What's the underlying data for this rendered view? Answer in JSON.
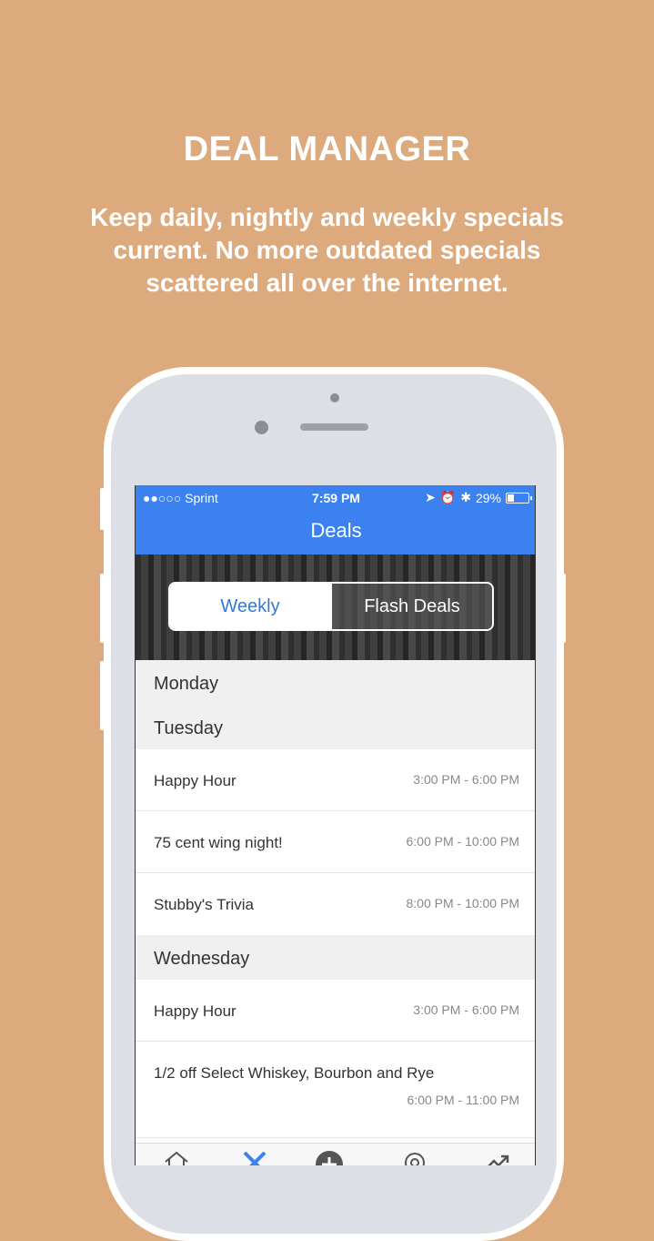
{
  "promo": {
    "headline": "DEAL MANAGER",
    "subtitle": "Keep daily, nightly and weekly specials current. No more outdated specials scattered all over the internet."
  },
  "status_bar": {
    "carrier": "●●○○○ Sprint",
    "time": "7:59 PM",
    "battery": "29%"
  },
  "nav": {
    "title": "Deals"
  },
  "segments": {
    "weekly": "Weekly",
    "flash": "Flash Deals"
  },
  "days": {
    "monday": "Monday",
    "tuesday": "Tuesday",
    "wednesday": "Wednesday"
  },
  "tuesday_deals": [
    {
      "name": "Happy Hour",
      "time": "3:00 PM - 6:00 PM"
    },
    {
      "name": "75 cent wing night!",
      "time": "6:00 PM - 10:00 PM"
    },
    {
      "name": "Stubby's Trivia",
      "time": "8:00 PM - 10:00 PM"
    }
  ],
  "wednesday_deals": [
    {
      "name": "Happy Hour",
      "time": "3:00 PM - 6:00 PM"
    },
    {
      "name": "1/2 off Select Whiskey, Bourbon and Rye",
      "time": "6:00 PM - 11:00 PM"
    }
  ],
  "tab_icons": [
    "home-icon",
    "utensils-icon",
    "add-icon",
    "settings-icon",
    "trending-icon"
  ],
  "colors": {
    "background": "#dcaa7c",
    "nav_blue": "#3b82f0",
    "accent_text": "#3478d6"
  }
}
